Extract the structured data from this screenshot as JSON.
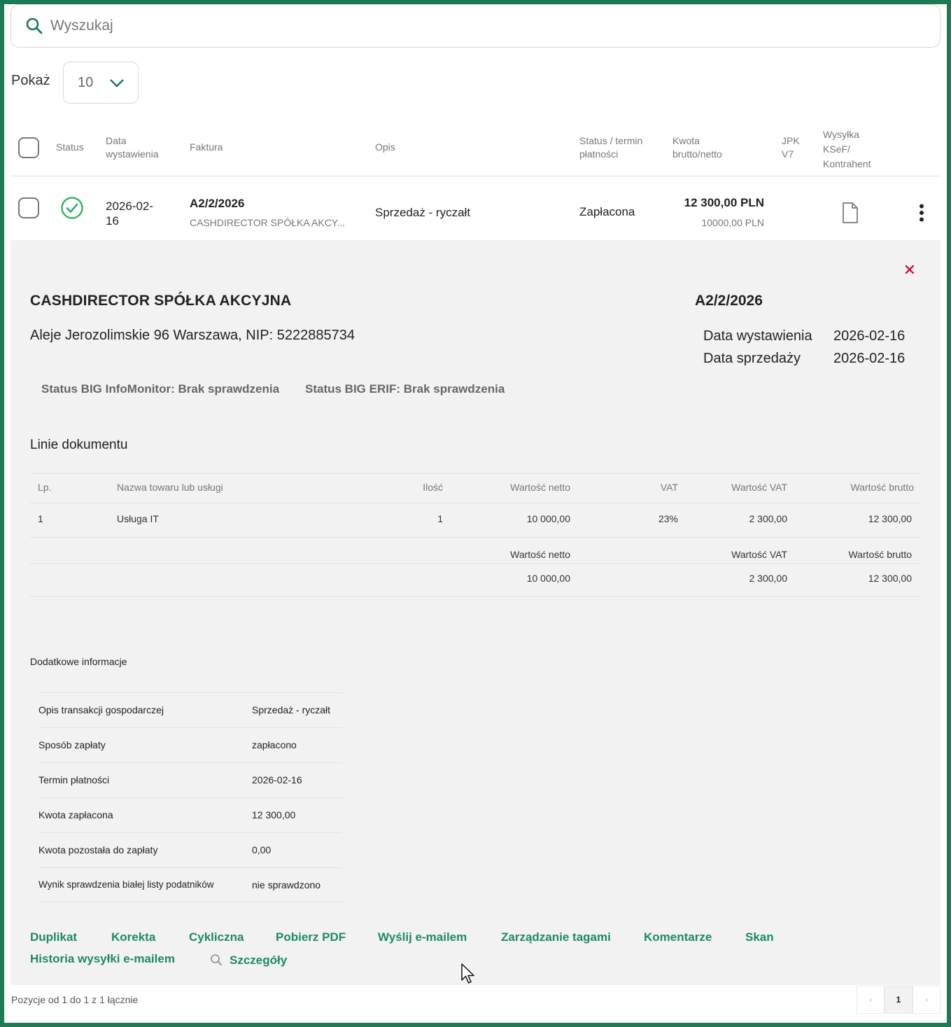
{
  "search": {
    "placeholder": "Wyszukaj"
  },
  "show": {
    "label": "Pokaż",
    "value": "10"
  },
  "table": {
    "headers": {
      "status": "Status",
      "date_l1": "Data",
      "date_l2": "wystawienia",
      "invoice": "Faktura",
      "desc": "Opis",
      "pay_l1": "Status / termin",
      "pay_l2": "płatności",
      "amount_l1": "Kwota",
      "amount_l2": "brutto/netto",
      "jpk_l1": "JPK",
      "jpk_l2": "V7",
      "ksef_l1": "Wysyłka",
      "ksef_l2": "KSeF/",
      "ksef_l3": "Kontrahent"
    },
    "row": {
      "date_l1": "2026-02-",
      "date_l2": "16",
      "invoice_no": "A2/2/2026",
      "invoice_client": "CASHDIRECTOR SPÓŁKA AKCY...",
      "desc": "Sprzedaż - ryczałt",
      "pay_status": "Zapłacona",
      "gross": "12 300,00 PLN",
      "net": "10000,00 PLN"
    }
  },
  "details": {
    "company": "CASHDIRECTOR SPÓŁKA AKCYJNA",
    "address": "Aleje Jerozolimskie 96 Warszawa, NIP: 5222885734",
    "invoice_no": "A2/2/2026",
    "issue_label": "Data wystawienia",
    "issue_date": "2026-02-16",
    "sale_label": "Data sprzedaży",
    "sale_date": "2026-02-16",
    "big_infomonitor": "Status BIG InfoMonitor: Brak sprawdzenia",
    "big_erif": "Status BIG ERIF: Brak sprawdzenia",
    "lines_title": "Linie dokumentu",
    "lines_headers": {
      "lp": "Lp.",
      "name": "Nazwa towaru lub usługi",
      "qty": "Ilość",
      "net": "Wartość netto",
      "vat": "VAT",
      "vat_value": "Wartość VAT",
      "gross": "Wartość brutto"
    },
    "line": {
      "lp": "1",
      "name": "Usługa IT",
      "qty": "1",
      "net": "10 000,00",
      "vat": "23%",
      "vat_value": "2 300,00",
      "gross": "12 300,00"
    },
    "totals": {
      "net_label": "Wartość netto",
      "vat_label": "Wartość VAT",
      "gross_label": "Wartość brutto",
      "net": "10 000,00",
      "vat": "2 300,00",
      "gross": "12 300,00"
    },
    "additional_title": "Dodatkowe informacje",
    "additional": [
      {
        "key": "Opis transakcji gospodarczej",
        "value": "Sprzedaż - ryczałt"
      },
      {
        "key": "Sposób zapłaty",
        "value": "zapłacono"
      },
      {
        "key": "Termin płatności",
        "value": "2026-02-16"
      },
      {
        "key": "Kwota zapłacona",
        "value": "12 300,00"
      },
      {
        "key": "Kwota pozostała do zapłaty",
        "value": "0,00"
      },
      {
        "key": "Wynik sprawdzenia białej listy podatników",
        "value": "nie sprawdzono"
      }
    ],
    "actions": {
      "duplikat": "Duplikat",
      "korekta": "Korekta",
      "cykliczna": "Cykliczna",
      "pdf": "Pobierz PDF",
      "email": "Wyślij e-mailem",
      "tags": "Zarządzanie tagami",
      "comments": "Komentarze",
      "scan": "Skan",
      "history": "Historia wysyłki e-mailem",
      "details": "Szczegóły"
    }
  },
  "footer": {
    "summary": "Pozycje od 1 do 1 z 1 łącznie",
    "page_prev": "‹",
    "page_current": "1",
    "page_next": "›"
  },
  "colors": {
    "brand": "#1e7a55",
    "link": "#1e8a62",
    "close": "#d0021b",
    "success": "#3bb56c"
  },
  "icons": [
    "search-icon",
    "chevron-down-icon",
    "check-circle-icon",
    "document-icon",
    "kebab-menu-icon",
    "close-icon",
    "magnifier-icon",
    "mouse-cursor-icon"
  ]
}
